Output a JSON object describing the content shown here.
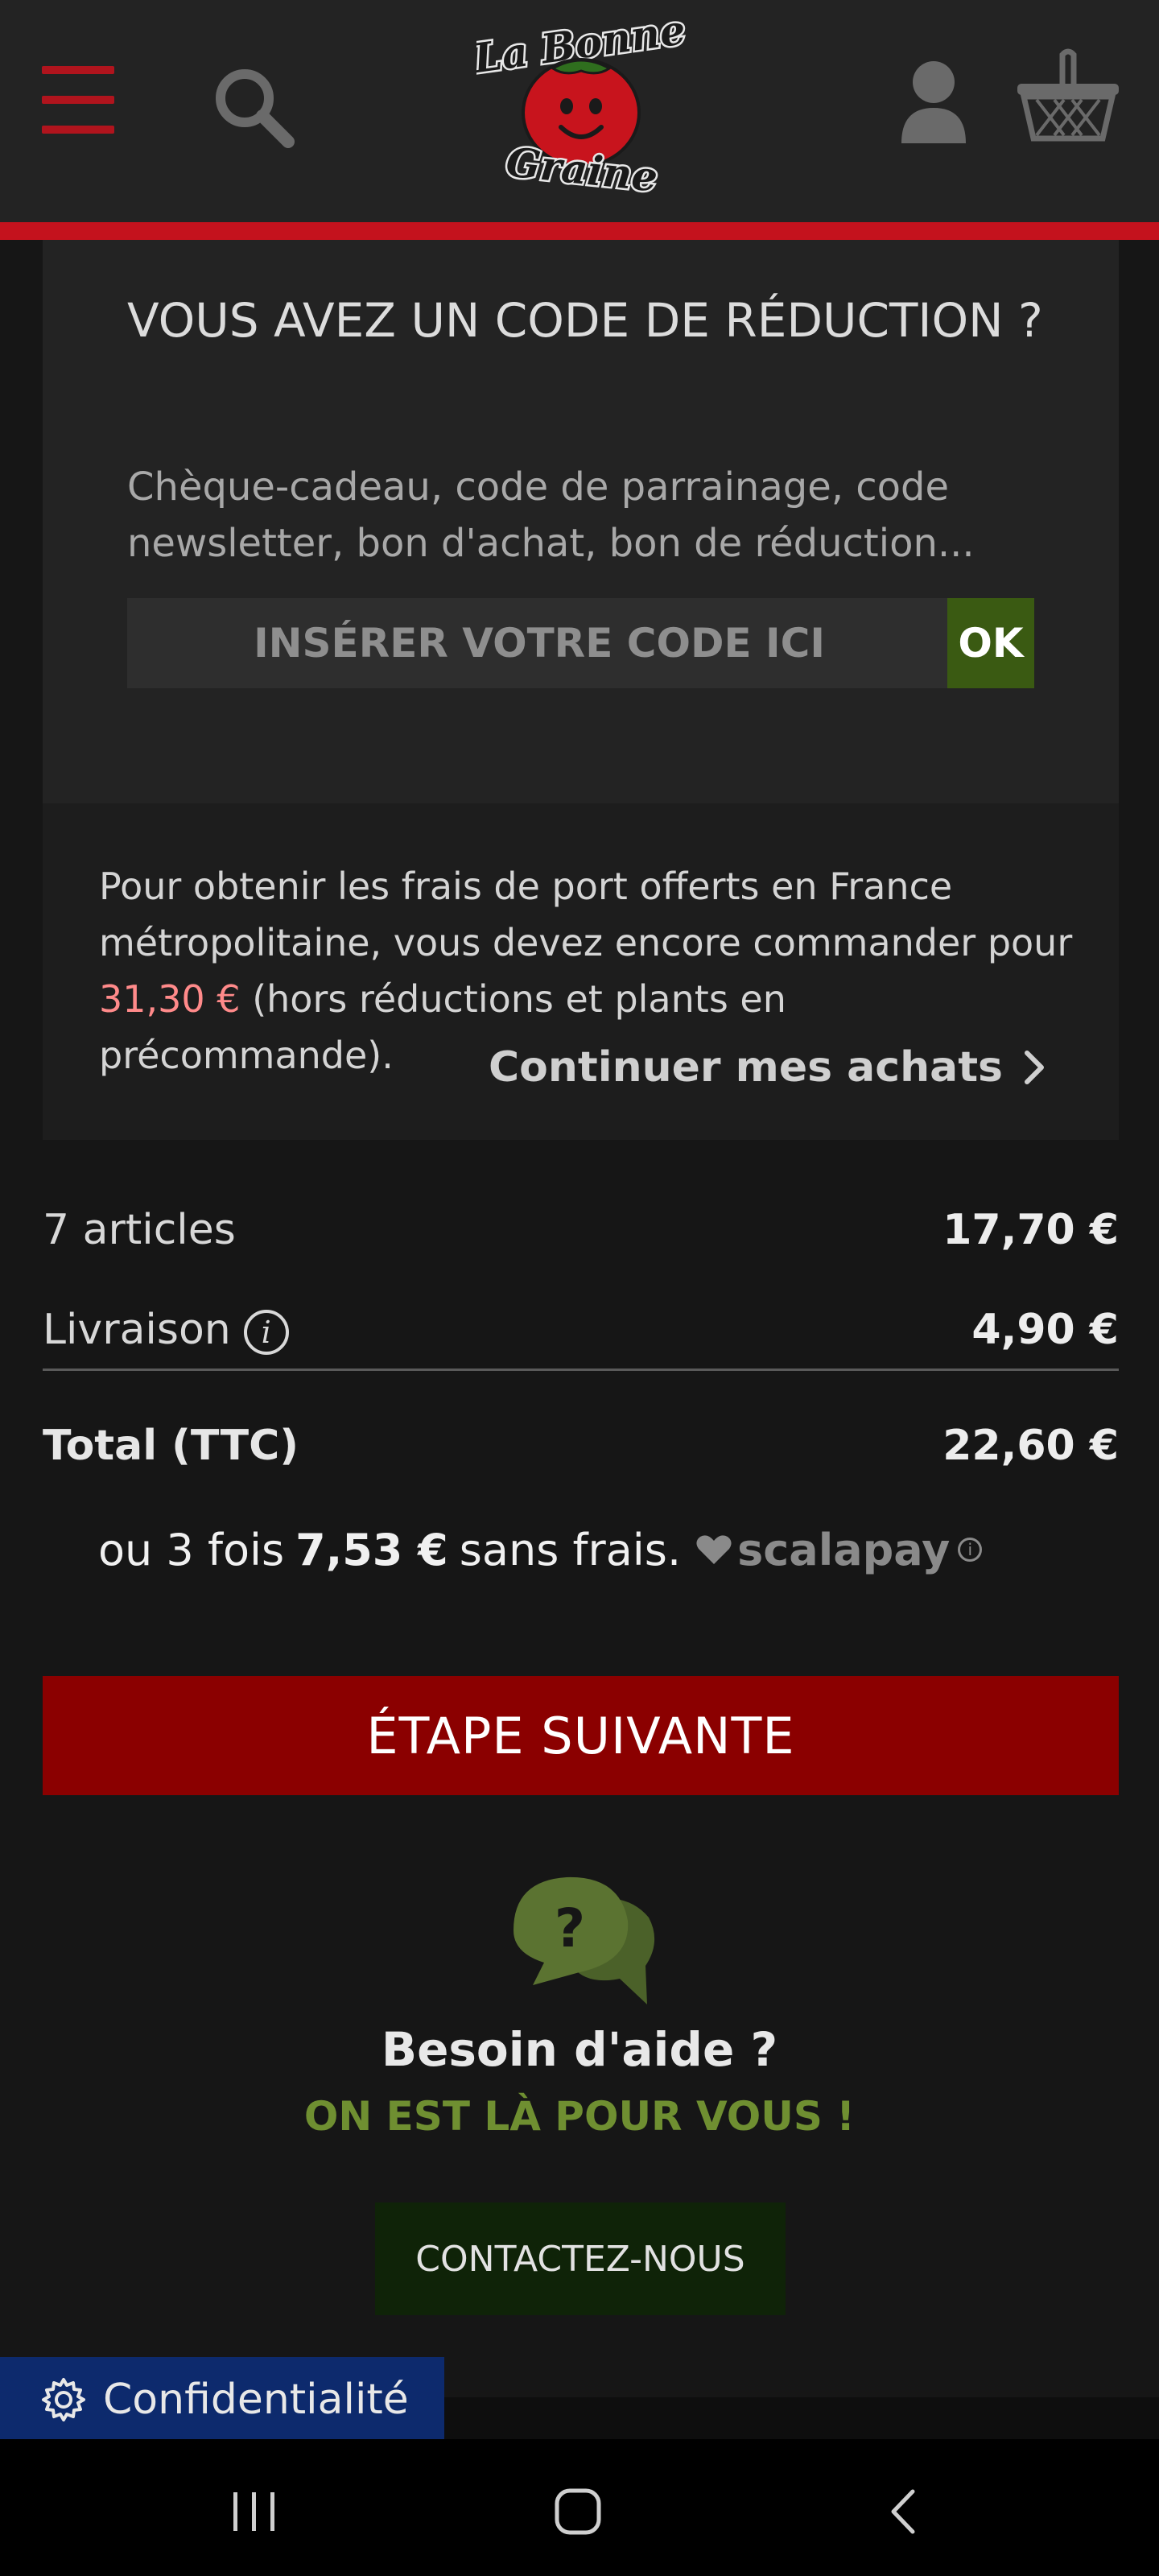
{
  "header": {
    "brand": "La Bonne Graine",
    "logo_line1": "La Bonne",
    "logo_line2": "Graine",
    "menu_icon": "hamburger-menu-icon",
    "search_icon": "search-icon",
    "account_icon": "user-icon",
    "cart_icon": "basket-icon",
    "accent_color": "#c4121d"
  },
  "coupon": {
    "title": "VOUS AVEZ UN CODE DE RÉDUCTION ?",
    "description": "Chèque-cadeau, code de parrainage, code newsletter, bon d'achat, bon de réduction...",
    "placeholder": "INSÉRER VOTRE CODE ICI",
    "value": "",
    "ok_label": "OK"
  },
  "shipping": {
    "text_before": "Pour obtenir les frais de port offerts en France métropolitaine, vous devez encore commander pour",
    "amount": "31,30 €",
    "text_after": "(hors réductions et plants en précommande).",
    "continue_label": "Continuer mes achats"
  },
  "summary": {
    "articles_label": "7 articles",
    "articles_value": "17,70 €",
    "delivery_label": "Livraison",
    "delivery_value": "4,90 €",
    "total_label": "Total (TTC)",
    "total_value": "22,60 €"
  },
  "scalapay": {
    "prefix": "ou 3 fois",
    "amount": "7,53 €",
    "suffix": "sans frais.",
    "brand": "scalapay",
    "info_label": "i"
  },
  "next_step_label": "ÉTAPE SUIVANTE",
  "help": {
    "icon": "chat-question-icon",
    "title": "Besoin d'aide ?",
    "subtitle": "ON EST LÀ POUR VOUS !",
    "contact_label": "CONTACTEZ-NOUS"
  },
  "privacy_label": "Confidentialité",
  "colors": {
    "next_button": "#8b0000",
    "ok_button": "#3a5a12",
    "help_green": "#6f8f31",
    "privacy_blue": "#0d2a6d"
  }
}
